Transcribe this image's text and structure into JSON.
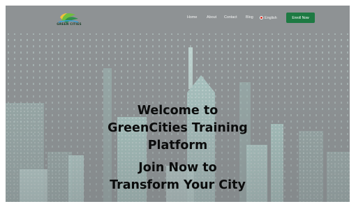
{
  "nav": {
    "logo_text": "GREEN CITIES",
    "links": [
      "Home",
      "About",
      "Contact",
      "Blog"
    ],
    "language": "English",
    "enroll_label": "Enroll Now"
  },
  "hero": {
    "title_lines": [
      "Welcome to",
      "GreenCities Training",
      "Platform"
    ],
    "cta_lines": [
      "Join Now to",
      "Transform Your City"
    ]
  },
  "colors": {
    "enroll_button": "#1e7a43",
    "overlay": "#8d9193",
    "building_glow": "#bfeee6"
  },
  "icons": {
    "logo": "green-cities-logo-icon",
    "flag": "english-flag-icon"
  }
}
